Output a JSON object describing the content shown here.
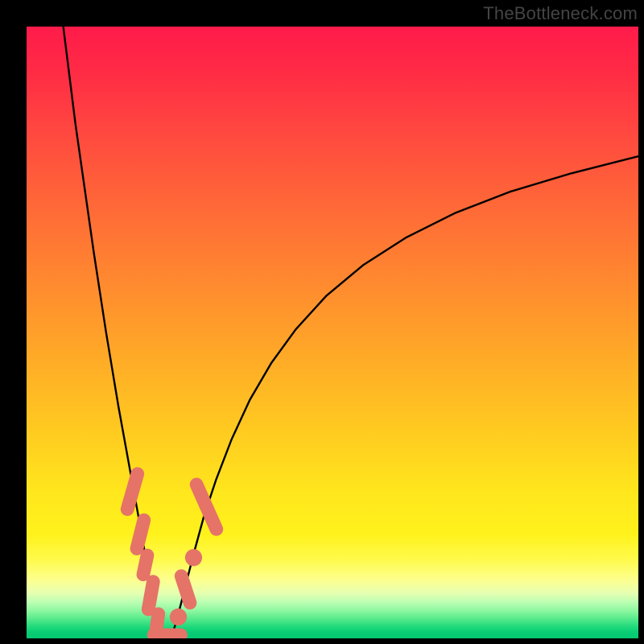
{
  "watermark": {
    "text": "TheBottleneck.com"
  },
  "colors": {
    "bg_black": "#000000",
    "curve": "#000000",
    "marker": "#e57368",
    "marker_green": "#05c872"
  },
  "chart_data": {
    "type": "line",
    "title": "",
    "xlabel": "",
    "ylabel": "",
    "xlim": [
      0,
      100
    ],
    "ylim": [
      0,
      100
    ],
    "series": [
      {
        "name": "left-branch",
        "x": [
          6,
          7,
          8,
          9,
          10,
          11,
          12,
          13,
          14,
          15,
          16,
          17,
          18,
          19,
          19.8,
          20.5,
          21.1,
          21.6,
          22.0
        ],
        "y": [
          100,
          92,
          84,
          77,
          70,
          63,
          56.5,
          50,
          44,
          38,
          32.5,
          27,
          21.5,
          16,
          11,
          7,
          4,
          2,
          0.6
        ]
      },
      {
        "name": "right-branch",
        "x": [
          23.8,
          24.4,
          25.2,
          26.2,
          27.5,
          29,
          31,
          33.5,
          36.5,
          40,
          44,
          49,
          55,
          62,
          70,
          79,
          89,
          100
        ],
        "y": [
          0.6,
          2.5,
          5.5,
          9.5,
          14.5,
          20,
          26,
          32.5,
          39,
          45,
          50.5,
          56,
          61,
          65.5,
          69.5,
          73,
          76,
          78.8
        ]
      },
      {
        "name": "floor",
        "x": [
          22.0,
          22.6,
          23.2,
          23.8
        ],
        "y": [
          0.6,
          0.4,
          0.4,
          0.6
        ]
      }
    ],
    "markers": [
      {
        "shape": "capsule",
        "cx": 17.3,
        "cy": 24.0,
        "angle_deg": 74,
        "len": 6.0,
        "w": 2.2
      },
      {
        "shape": "capsule",
        "cx": 18.6,
        "cy": 17.0,
        "angle_deg": 76,
        "len": 4.8,
        "w": 2.2
      },
      {
        "shape": "capsule",
        "cx": 19.4,
        "cy": 12.0,
        "angle_deg": 78,
        "len": 3.2,
        "w": 2.2
      },
      {
        "shape": "capsule",
        "cx": 20.3,
        "cy": 7.0,
        "angle_deg": 80,
        "len": 4.6,
        "w": 2.2
      },
      {
        "shape": "capsule",
        "cx": 21.3,
        "cy": 2.2,
        "angle_deg": 82,
        "len": 3.6,
        "w": 2.2
      },
      {
        "shape": "capsule",
        "cx": 23.0,
        "cy": 0.55,
        "angle_deg": 0,
        "len": 4.4,
        "w": 2.2
      },
      {
        "shape": "dot",
        "cx": 24.8,
        "cy": 3.5,
        "r": 1.4
      },
      {
        "shape": "capsule",
        "cx": 26.0,
        "cy": 8.0,
        "angle_deg": -72,
        "len": 4.6,
        "w": 2.2
      },
      {
        "shape": "dot",
        "cx": 27.3,
        "cy": 13.2,
        "r": 1.4
      },
      {
        "shape": "capsule",
        "cx": 29.4,
        "cy": 21.5,
        "angle_deg": -66,
        "len": 8.0,
        "w": 2.2
      }
    ]
  }
}
